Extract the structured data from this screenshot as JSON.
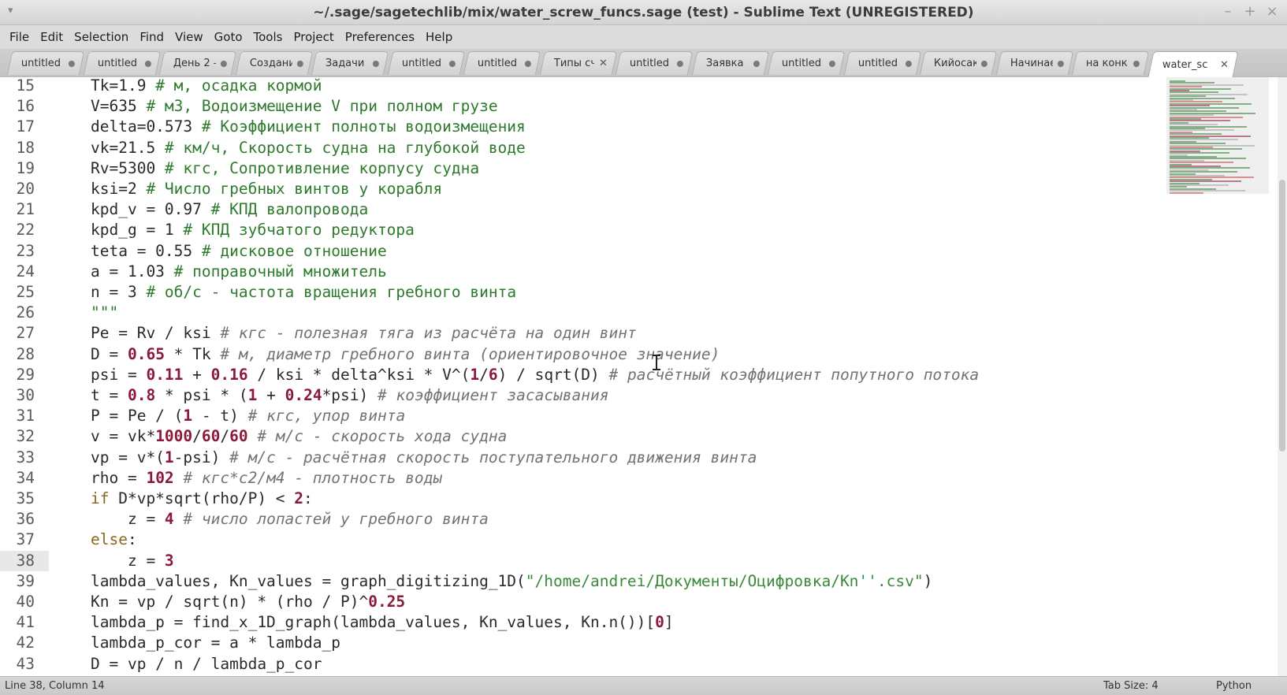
{
  "window": {
    "title": "~/.sage/sagetechlib/mix/water_screw_funcs.sage (test) - Sublime Text (UNREGISTERED)",
    "menu_icon": "window-menu-icon",
    "minimize": "–",
    "maximize": "+",
    "close": "×"
  },
  "menu": [
    "File",
    "Edit",
    "Selection",
    "Find",
    "View",
    "Goto",
    "Tools",
    "Project",
    "Preferences",
    "Help"
  ],
  "tabs": [
    {
      "label": "untitled",
      "marker": "dot"
    },
    {
      "label": "untitled",
      "marker": "dot"
    },
    {
      "label": "День 2 -",
      "marker": "dot"
    },
    {
      "label": "Создани",
      "marker": "dot"
    },
    {
      "label": "Задачи",
      "marker": "dot"
    },
    {
      "label": "untitled",
      "marker": "dot"
    },
    {
      "label": "untitled",
      "marker": "dot"
    },
    {
      "label": "Типы сч",
      "marker": "close"
    },
    {
      "label": "untitled",
      "marker": "dot"
    },
    {
      "label": "Заявка",
      "marker": "dot"
    },
    {
      "label": "untitled",
      "marker": "dot"
    },
    {
      "label": "untitled",
      "marker": "dot"
    },
    {
      "label": "Кийосак",
      "marker": "dot"
    },
    {
      "label": "Начинае",
      "marker": "dot"
    },
    {
      "label": "на конк",
      "marker": "dot"
    },
    {
      "label": "water_sc",
      "marker": "close",
      "active": true
    }
  ],
  "editor": {
    "current_line": 38,
    "lines": [
      {
        "n": "15",
        "tokens": [
          [
            "v",
            "Tk=1.9 "
          ],
          [
            "c",
            "# м, осадка кормой"
          ]
        ]
      },
      {
        "n": "16",
        "tokens": [
          [
            "v",
            "V=635 "
          ],
          [
            "c",
            "# м3, Водоизмещение V при полном грузе"
          ]
        ]
      },
      {
        "n": "17",
        "tokens": [
          [
            "v",
            "delta=0.573 "
          ],
          [
            "c",
            "# Коэффициент полноты водоизмещения"
          ]
        ]
      },
      {
        "n": "18",
        "tokens": [
          [
            "v",
            "vk=21.5 "
          ],
          [
            "c",
            "# км/ч, Скорость судна на глубокой воде"
          ]
        ]
      },
      {
        "n": "19",
        "tokens": [
          [
            "v",
            "Rv=5300 "
          ],
          [
            "c",
            "# кгс, Сопротивление корпусу судна"
          ]
        ]
      },
      {
        "n": "20",
        "tokens": [
          [
            "v",
            "ksi=2 "
          ],
          [
            "c",
            "# Число гребных винтов у корабля"
          ]
        ]
      },
      {
        "n": "21",
        "tokens": [
          [
            "v",
            "kpd_v = 0.97 "
          ],
          [
            "c",
            "# КПД валопровода"
          ]
        ]
      },
      {
        "n": "22",
        "tokens": [
          [
            "v",
            "kpd_g = 1 "
          ],
          [
            "c",
            "# КПД зубчатого редуктора"
          ]
        ]
      },
      {
        "n": "23",
        "tokens": [
          [
            "v",
            "teta = 0.55 "
          ],
          [
            "c",
            "# дисковое отношение"
          ]
        ]
      },
      {
        "n": "24",
        "tokens": [
          [
            "v",
            "a = 1.03 "
          ],
          [
            "c",
            "# поправочный множитель"
          ]
        ]
      },
      {
        "n": "25",
        "tokens": [
          [
            "v",
            "n = 3 "
          ],
          [
            "c",
            "# об/с - частота вращения гребного винта"
          ]
        ]
      },
      {
        "n": "26",
        "tokens": [
          [
            "c",
            "\"\"\""
          ]
        ]
      },
      {
        "n": "27",
        "tokens": [
          [
            "v",
            "Pe = Rv / ksi "
          ],
          [
            "i",
            "# кгс - полезная тяга из расчёта на один винт"
          ]
        ]
      },
      {
        "n": "28",
        "tokens": [
          [
            "v",
            "D = "
          ],
          [
            "n",
            "0.65"
          ],
          [
            "v",
            " * Tk "
          ],
          [
            "i",
            "# м, диаметр гребного винта (ориентировочное значение)"
          ]
        ]
      },
      {
        "n": "29",
        "tokens": [
          [
            "v",
            "psi = "
          ],
          [
            "n",
            "0.11"
          ],
          [
            "v",
            " + "
          ],
          [
            "n",
            "0.16"
          ],
          [
            "v",
            " / ksi * delta^ksi * V^("
          ],
          [
            "n",
            "1"
          ],
          [
            "v",
            "/"
          ],
          [
            "n",
            "6"
          ],
          [
            "v",
            ") / sqrt(D) "
          ],
          [
            "i",
            "# расчётный коэффициент попутного потока"
          ]
        ]
      },
      {
        "n": "30",
        "tokens": [
          [
            "v",
            "t = "
          ],
          [
            "n",
            "0.8"
          ],
          [
            "v",
            " * psi * ("
          ],
          [
            "n",
            "1"
          ],
          [
            "v",
            " + "
          ],
          [
            "n",
            "0.24"
          ],
          [
            "v",
            "*psi) "
          ],
          [
            "i",
            "# коэффициент засасывания"
          ]
        ]
      },
      {
        "n": "31",
        "tokens": [
          [
            "v",
            "P = Pe / ("
          ],
          [
            "n",
            "1"
          ],
          [
            "v",
            " - t) "
          ],
          [
            "i",
            "# кгс, упор винта"
          ]
        ]
      },
      {
        "n": "32",
        "tokens": [
          [
            "v",
            "v = vk*"
          ],
          [
            "n",
            "1000"
          ],
          [
            "v",
            "/"
          ],
          [
            "n",
            "60"
          ],
          [
            "v",
            "/"
          ],
          [
            "n",
            "60"
          ],
          [
            "v",
            " "
          ],
          [
            "i",
            "# м/с - скорость хода судна"
          ]
        ]
      },
      {
        "n": "33",
        "tokens": [
          [
            "v",
            "vp = v*("
          ],
          [
            "n",
            "1"
          ],
          [
            "v",
            "-psi) "
          ],
          [
            "i",
            "# м/с - расчётная скорость поступательного движения винта"
          ]
        ]
      },
      {
        "n": "34",
        "tokens": [
          [
            "v",
            "rho = "
          ],
          [
            "n",
            "102"
          ],
          [
            "v",
            " "
          ],
          [
            "i",
            "# кгс*с2/м4 - плотность воды"
          ]
        ]
      },
      {
        "n": "35",
        "tokens": [
          [
            "k",
            "if"
          ],
          [
            "v",
            " D*vp*sqrt(rho/P) < "
          ],
          [
            "n",
            "2"
          ],
          [
            "v",
            ":"
          ]
        ]
      },
      {
        "n": "36",
        "tokens": [
          [
            "v",
            "    z = "
          ],
          [
            "n",
            "4"
          ],
          [
            "v",
            " "
          ],
          [
            "i",
            "# число лопастей у гребного винта"
          ]
        ]
      },
      {
        "n": "37",
        "tokens": [
          [
            "k",
            "else"
          ],
          [
            "v",
            ":"
          ]
        ]
      },
      {
        "n": "38",
        "tokens": [
          [
            "v",
            "    z = "
          ],
          [
            "n",
            "3"
          ]
        ]
      },
      {
        "n": "39",
        "tokens": [
          [
            "v",
            "lambda_values, Kn_values = graph_digitizing_1D("
          ],
          [
            "s",
            "\"/home/andrei/Документы/Оцифровка/Kn''.csv\""
          ],
          [
            "v",
            ")"
          ]
        ]
      },
      {
        "n": "40",
        "tokens": [
          [
            "v",
            "Kn = vp / sqrt(n) * (rho / P)^"
          ],
          [
            "n",
            "0.25"
          ]
        ]
      },
      {
        "n": "41",
        "tokens": [
          [
            "v",
            "lambda_p = find_x_1D_graph(lambda_values, Kn_values, Kn.n())["
          ],
          [
            "n",
            "0"
          ],
          [
            "v",
            "]"
          ]
        ]
      },
      {
        "n": "42",
        "tokens": [
          [
            "v",
            "lambda_p_cor = a * lambda_p"
          ]
        ]
      },
      {
        "n": "43",
        "tokens": [
          [
            "v",
            "D = vp / n / lambda_p_cor"
          ]
        ]
      }
    ]
  },
  "status": {
    "position": "Line 38, Column 14",
    "tab_size": "Tab Size: 4",
    "syntax": "Python"
  },
  "colors": {
    "comment_green": "#2d7a2d",
    "comment_italic": "#737373",
    "number": "#8b1a3a",
    "keyword": "#8a6a1a"
  }
}
